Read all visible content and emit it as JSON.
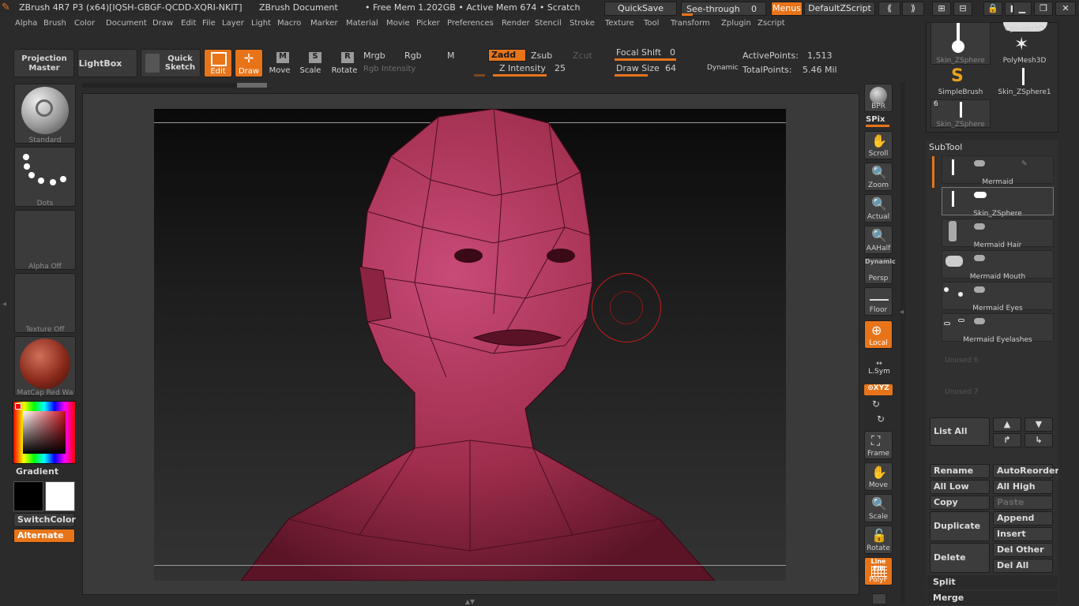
{
  "title": {
    "app": "ZBrush 4R7 P3 (x64)[IQSH-GBGF-QCDD-XQRI-NKIT]",
    "document": "ZBrush Document",
    "stats": "• Free Mem 1.202GB • Active Mem 674 • Scratch",
    "quicksave": "QuickSave",
    "seethrough_label": "See-through",
    "seethrough_value": "0",
    "menus": "Menus",
    "defaultzscript": "DefaultZScript"
  },
  "menubar": [
    "Alpha",
    "Brush",
    "Color",
    "Document",
    "Draw",
    "Edit",
    "File",
    "Layer",
    "Light",
    "Macro",
    "Marker",
    "Material",
    "Movie",
    "Picker",
    "Preferences",
    "Render",
    "Stencil",
    "Stroke",
    "Texture",
    "Tool",
    "Transform",
    "Zplugin",
    "Zscript"
  ],
  "toolbar": {
    "projection_master": "Projection Master",
    "lightbox": "LightBox",
    "quick_sketch": "Quick Sketch",
    "edit": "Edit",
    "draw": "Draw",
    "move": "Move",
    "scale": "Scale",
    "rotate": "Rotate",
    "mrgb": "Mrgb",
    "rgb": "Rgb",
    "m": "M",
    "zadd": "Zadd",
    "zsub": "Zsub",
    "zcut": "Zcut",
    "rgb_intensity": "Rgb Intensity",
    "z_intensity_label": "Z Intensity",
    "z_intensity_value": "25",
    "focal_shift_label": "Focal Shift",
    "focal_shift_value": "0",
    "draw_size_label": "Draw Size",
    "draw_size_value": "64",
    "dynamic": "Dynamic",
    "active_points_label": "ActivePoints:",
    "active_points_value": "1,513",
    "total_points_label": "TotalPoints:",
    "total_points_value": "5.46 Mil"
  },
  "leftshelf": {
    "brush": "Standard",
    "stroke": "Dots",
    "alpha": "Alpha  Off",
    "texture": "Texture  Off",
    "material": "MatCap  Red  Wa",
    "gradient": "Gradient",
    "switchcolor": "SwitchColor",
    "alternate": "Alternate"
  },
  "rightshelf": {
    "bpr": "BPR",
    "spix": "SPix",
    "scroll": "Scroll",
    "zoom": "Zoom",
    "actual": "Actual",
    "aahalf": "AAHalf",
    "dynamic": "Dynamic",
    "persp": "Persp",
    "floor": "Floor",
    "local": "Local",
    "lsym": "L.Sym",
    "xyz": "⊙XYZ",
    "frame": "Frame",
    "move": "Move",
    "scale": "Scale",
    "rotate": "Rotate",
    "linefill": "Line Fill",
    "polyf": "PolyF"
  },
  "toolpalette": {
    "items": [
      "Skin_ZSphere",
      "PolyMesh3D",
      "SimpleBrush",
      "Skin_ZSphere1",
      "Skin_ZSphere"
    ],
    "cylinder": "Cylinder3D",
    "count": "6"
  },
  "subtool": {
    "header": "SubTool",
    "items": [
      "Mermaid",
      "Skin_ZSphere",
      "Mermaid  Hair",
      "Mermaid  Mouth",
      "Mermaid  Eyes",
      "Mermaid  Eyelashes"
    ],
    "unused": [
      "Unused  6",
      "Unused  7"
    ],
    "list_all": "List  All",
    "rename": "Rename",
    "autoreorder": "AutoReorder",
    "all_low": "All Low",
    "all_high": "All High",
    "copy": "Copy",
    "paste": "Paste",
    "duplicate": "Duplicate",
    "append": "Append",
    "insert": "Insert",
    "delete": "Delete",
    "del_other": "Del Other",
    "del_all": "Del All",
    "split": "Split",
    "merge": "Merge"
  },
  "colors": {
    "accent": "#e8741a",
    "model": "#a8304f",
    "panel": "#2b2b2b"
  }
}
